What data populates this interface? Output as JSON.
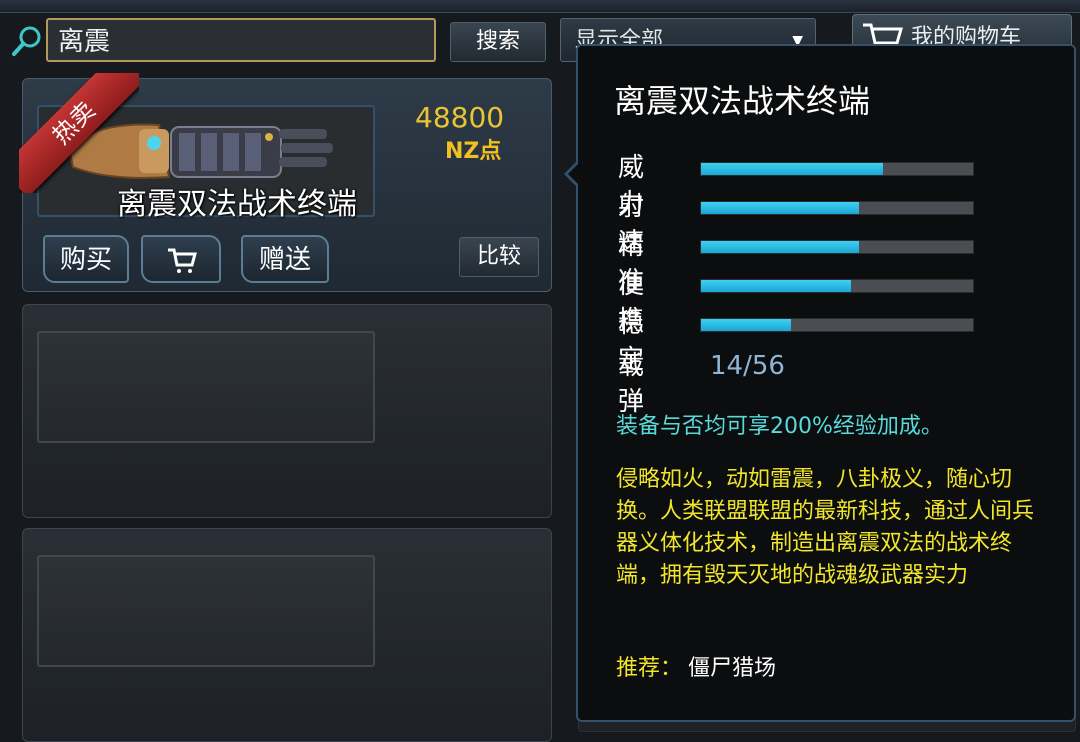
{
  "search": {
    "query": "离震",
    "button_label": "搜索"
  },
  "filter": {
    "selected": "显示全部"
  },
  "cart": {
    "label": "我的购物车"
  },
  "item": {
    "badge": "热卖",
    "name": "离震双法战术终端",
    "price": "48800",
    "currency": "NZ点",
    "actions": {
      "buy": "购买",
      "gift": "赠送",
      "compare": "比较"
    }
  },
  "tooltip": {
    "title": "离震双法战术终端",
    "stats": [
      {
        "label": "威力",
        "value": 0.67
      },
      {
        "label": "射速",
        "value": 0.58
      },
      {
        "label": "精准",
        "value": 0.58
      },
      {
        "label": "便携",
        "value": 0.55
      },
      {
        "label": "稳定",
        "value": 0.33
      }
    ],
    "ammo_label": "载弹",
    "ammo_value": "14/56",
    "bonus": "装备与否均可享200%经验加成。",
    "description": "侵略如火，动如雷震，八卦极义，随心切换。人类联盟联盟的最新科技，通过人间兵器义体化技术，制造出离震双法的战术终端，拥有毁天灭地的战魂级武器实力",
    "recommend_label": "推荐：",
    "recommend_value": "僵尸猎场"
  },
  "colors": {
    "stat_fill": "#22b8e0",
    "price": "#e9c534",
    "description": "#f2e62a",
    "bonus": "#59d9d9"
  }
}
